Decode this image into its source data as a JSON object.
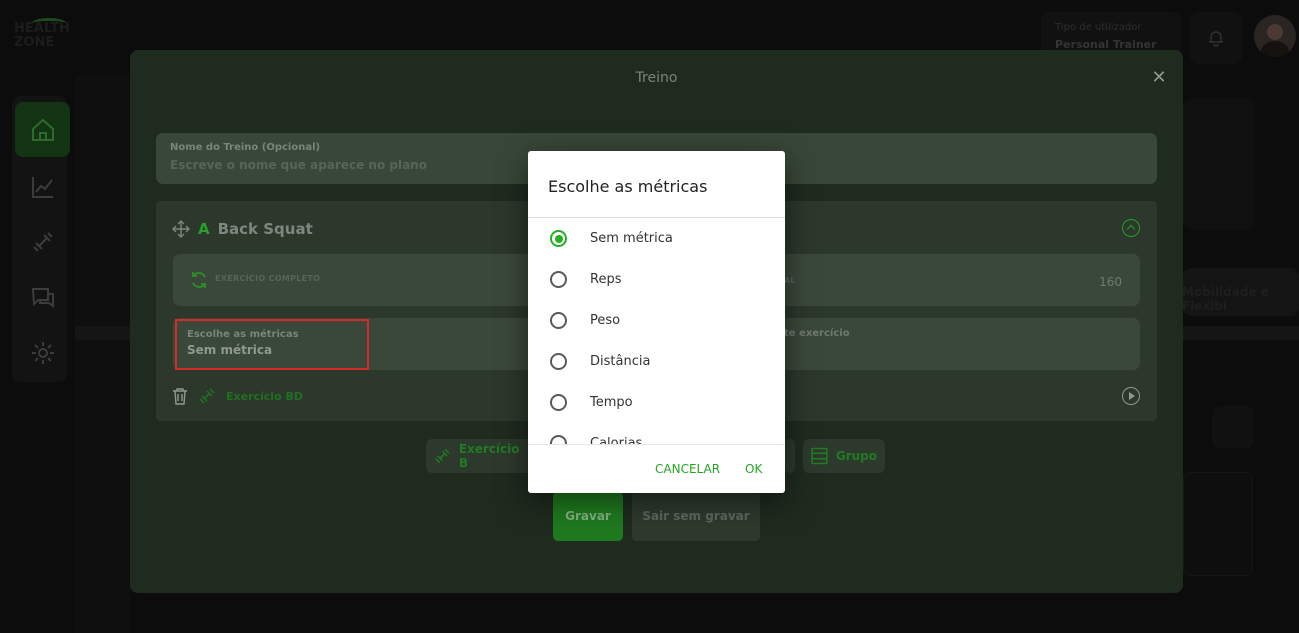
{
  "app": {
    "logo_line1": "HEALTH",
    "logo_line2": "ZONE"
  },
  "header": {
    "user_type_label": "Tipo de utilizador",
    "user_type_value": "Personal Trainer"
  },
  "sidebar": {
    "items": [
      {
        "icon": "home-icon",
        "active": true
      },
      {
        "icon": "chart-icon",
        "active": false
      },
      {
        "icon": "dumbbell-icon",
        "active": false
      },
      {
        "icon": "chat-icon",
        "active": false
      },
      {
        "icon": "gear-icon",
        "active": false
      }
    ]
  },
  "background": {
    "tab_text": "Mobilidade e Flexibi"
  },
  "modal": {
    "title": "Treino",
    "name_field": {
      "label": "Nome do Treino (Opcional)",
      "placeholder": "Escreve o nome que aparece no plano"
    },
    "exercise": {
      "letter": "A",
      "name": "Back Squat",
      "full_label": "EXERCÍCIO COMPLETO",
      "al_label": "AL",
      "value": "160",
      "metrics_label": "Escolhe as métricas",
      "metrics_value": "Sem métrica",
      "note_label": "te exercício",
      "db_label": "Exercício BD"
    },
    "add_buttons": {
      "exercise": "Exercício B",
      "group": "Grupo"
    },
    "save_label": "Gravar",
    "exit_label": "Sair sem gravar"
  },
  "dialog": {
    "title": "Escolhe as métricas",
    "options": [
      {
        "label": "Sem métrica",
        "selected": true
      },
      {
        "label": "Reps",
        "selected": false
      },
      {
        "label": "Peso",
        "selected": false
      },
      {
        "label": "Distância",
        "selected": false
      },
      {
        "label": "Tempo",
        "selected": false
      },
      {
        "label": "Calorias",
        "selected": false
      }
    ],
    "cancel_label": "CANCELAR",
    "ok_label": "OK"
  },
  "colors": {
    "accent": "#22b022",
    "highlight_border": "#d42a2a"
  }
}
